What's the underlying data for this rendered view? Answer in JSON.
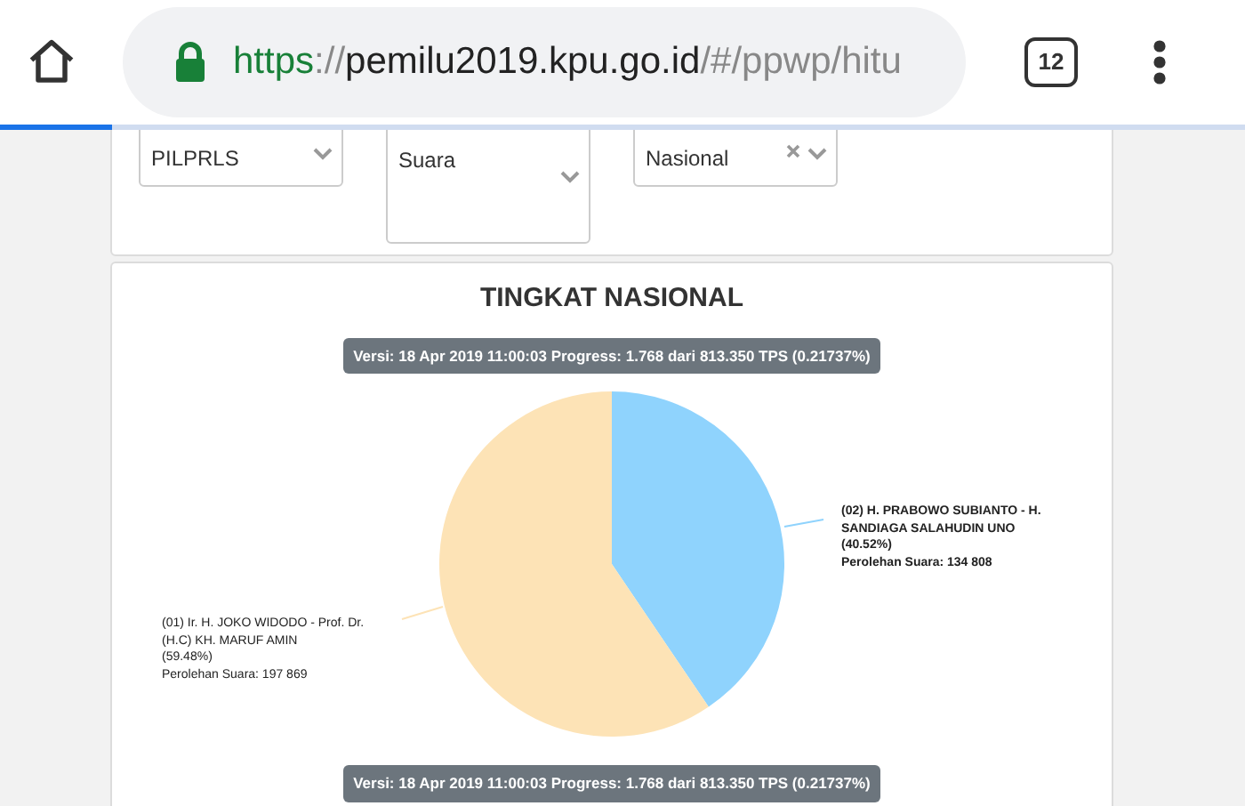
{
  "browser": {
    "url_scheme": "https",
    "url_separator": "://",
    "url_host": "pemilu2019.kpu.go.id",
    "url_path": "/#/ppwp/hitu",
    "tab_count": "12",
    "load_progress": {
      "level": 0.09
    }
  },
  "filters": [
    {
      "value": "PILPRLS",
      "clearable": false
    },
    {
      "value": "Suara",
      "clearable": false
    },
    {
      "value": "Nasional",
      "clearable": true
    }
  ],
  "result": {
    "title": "TINGKAT NASIONAL",
    "version_top": "Versi: 18 Apr 2019 11:00:03 Progress: 1.768 dari 813.350 TPS (0.21737%)",
    "chart_data": {
      "type": "pie",
      "categories": [
        "(01) Ir. H. JOKO WIDODO - Prof. Dr. (H.C) KH. MARUF AMIN",
        "(02) H. PRABOWO SUBIANTO - H. SANDIAGA SALAHUDIN UNO"
      ],
      "values": [
        59.48,
        40.52
      ]
    },
    "labels": [
      {
        "percent": "(59.48%)",
        "votes": "Perolehan Suara: 197 869",
        "color": "#fde3b6"
      },
      {
        "percent": "(40.52%)",
        "votes": "Perolehan Suara: 134 808",
        "color": "#8fd3fd"
      }
    ],
    "version_bottom": "Versi: 18 Apr 2019 11:00:03 Progress: 1.768 dari 813.350 TPS (0.21737%)"
  }
}
